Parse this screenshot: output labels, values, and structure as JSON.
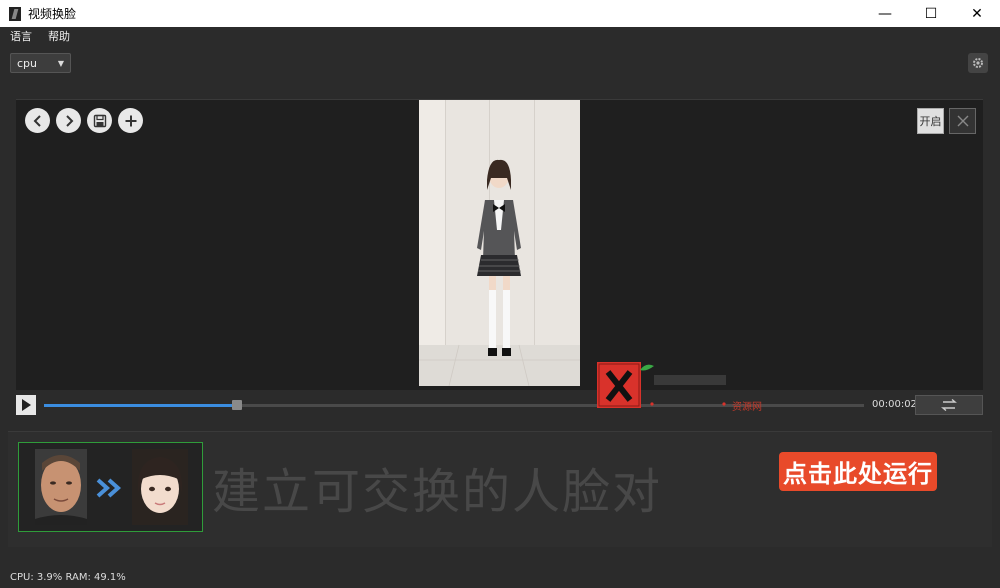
{
  "window": {
    "title": "视频换脸",
    "minimize": "—",
    "maximize": "☐",
    "close": "✕"
  },
  "menu": {
    "items": [
      "语言",
      "帮助"
    ]
  },
  "device": {
    "selected": "cpu"
  },
  "viewer": {
    "open_label": "开启"
  },
  "player": {
    "time": "00:00:02",
    "progress": 0.235
  },
  "faces": {
    "overlay_text": "建立可交换的人脸对",
    "run_label": "点击此处运行"
  },
  "watermark": {
    "sub": "资源网"
  },
  "status": {
    "text": "CPU: 3.9%  RAM: 49.1%"
  },
  "colors": {
    "accent": "#3b8de0",
    "selection": "#2f9c3a",
    "run_label_bg": "#e84a2a"
  }
}
